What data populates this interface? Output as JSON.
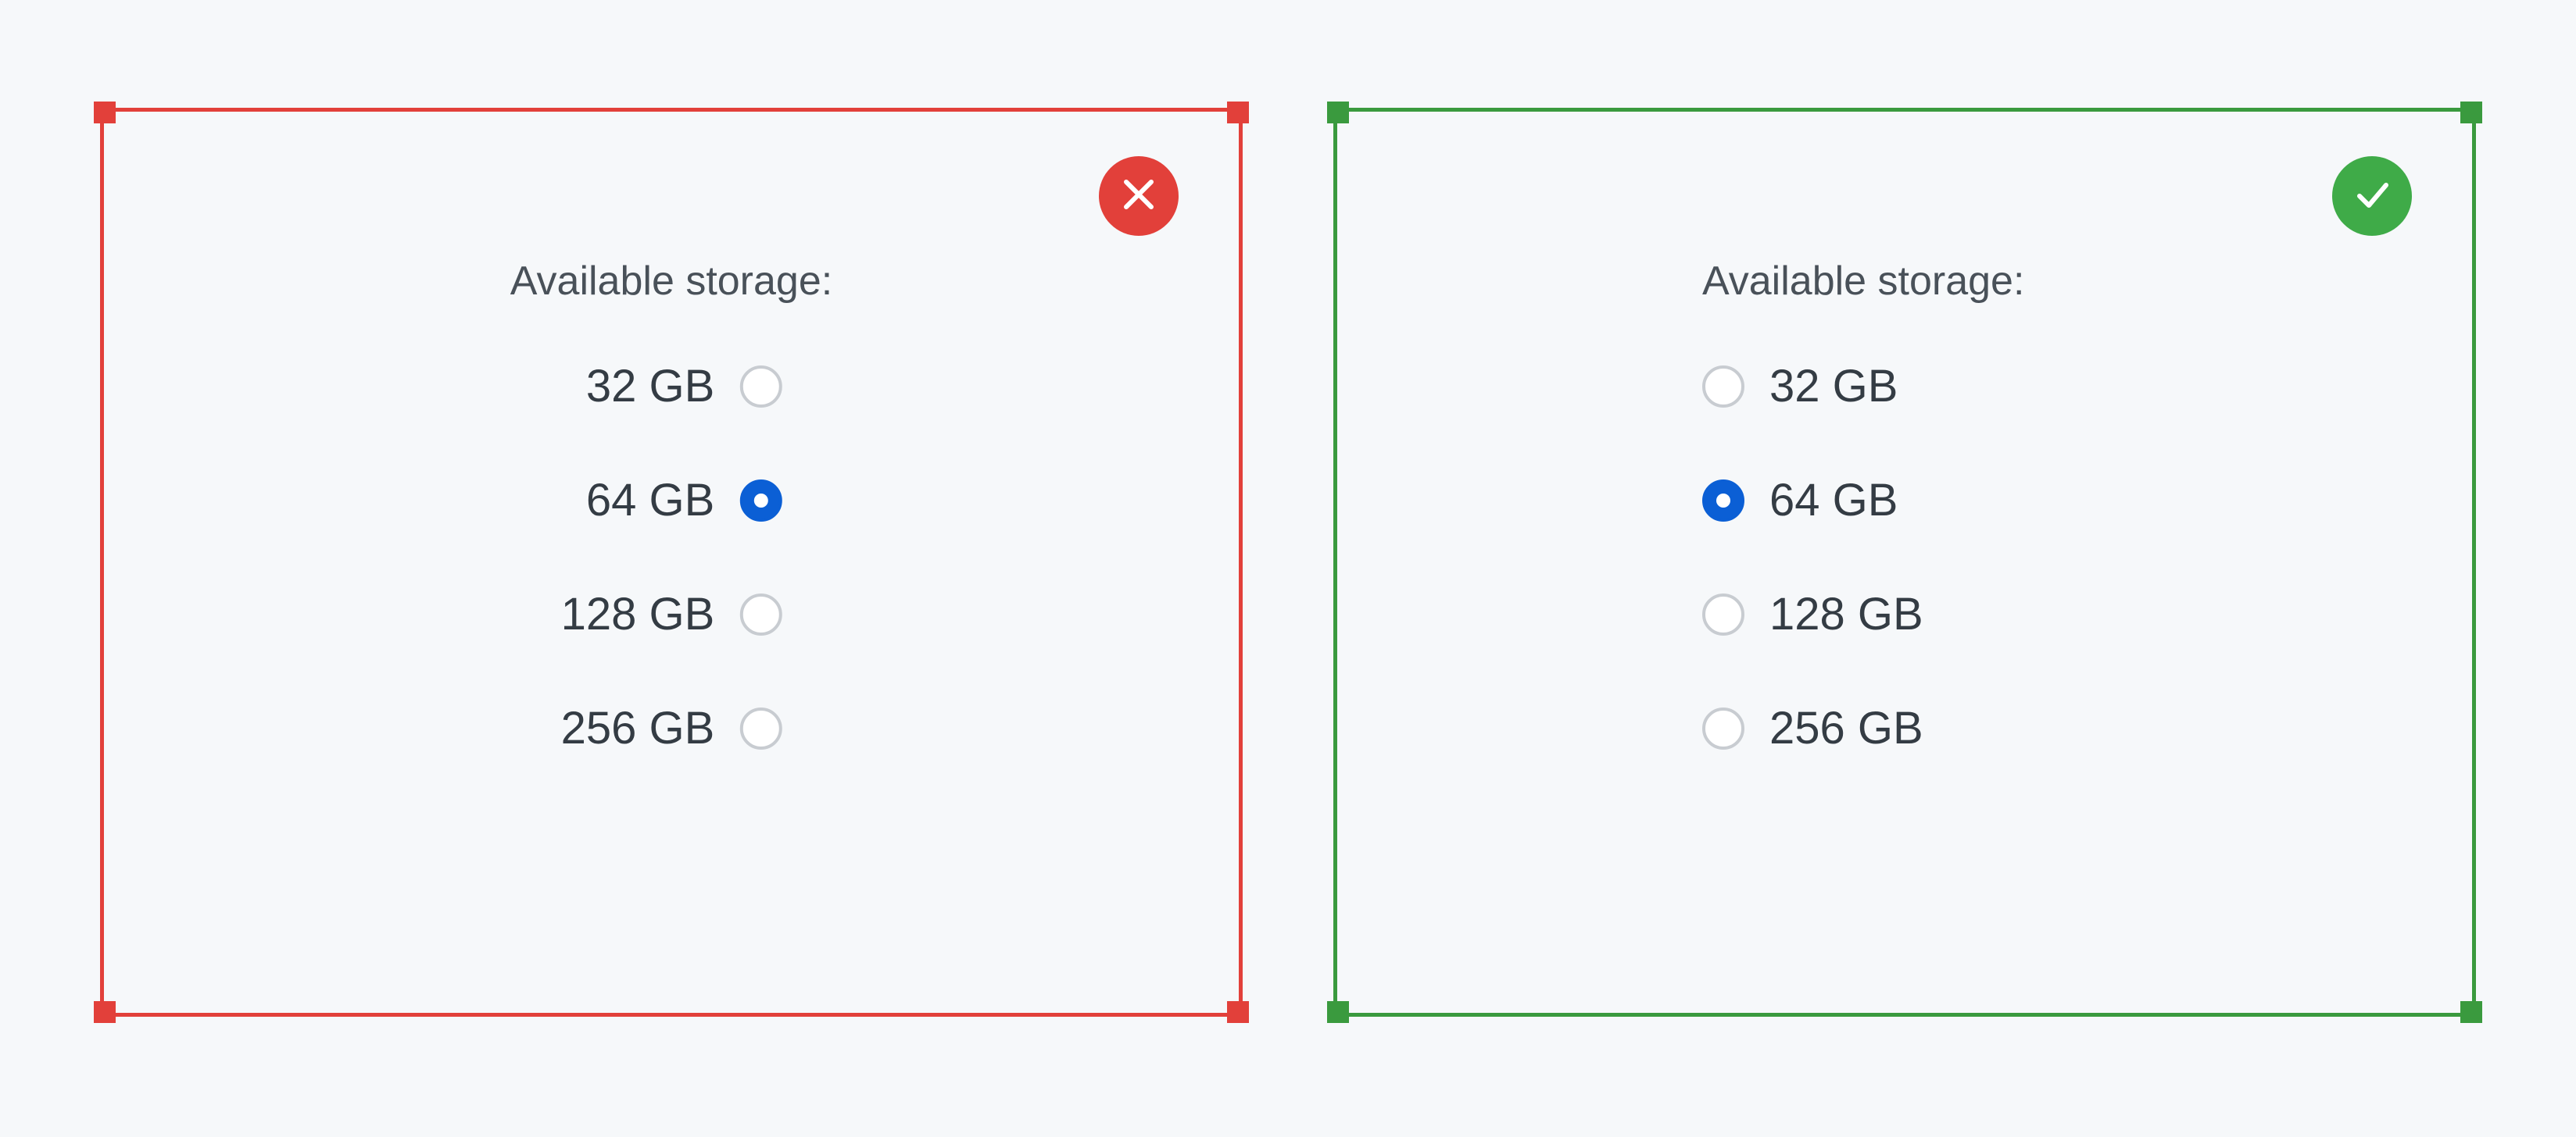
{
  "bad_example": {
    "group_label": "Available storage:",
    "selected": 1,
    "options": [
      {
        "label": "32 GB"
      },
      {
        "label": "64 GB"
      },
      {
        "label": "128 GB"
      },
      {
        "label": "256 GB"
      }
    ]
  },
  "good_example": {
    "group_label": "Available storage:",
    "selected": 1,
    "options": [
      {
        "label": "32 GB"
      },
      {
        "label": "64 GB"
      },
      {
        "label": "128 GB"
      },
      {
        "label": "256 GB"
      }
    ]
  },
  "colors": {
    "error": "#e2403a",
    "success": "#3fab48",
    "radio_selected": "#0b5fd5",
    "radio_border": "#c8ccd1",
    "text": "#343c44",
    "label": "#495159"
  }
}
